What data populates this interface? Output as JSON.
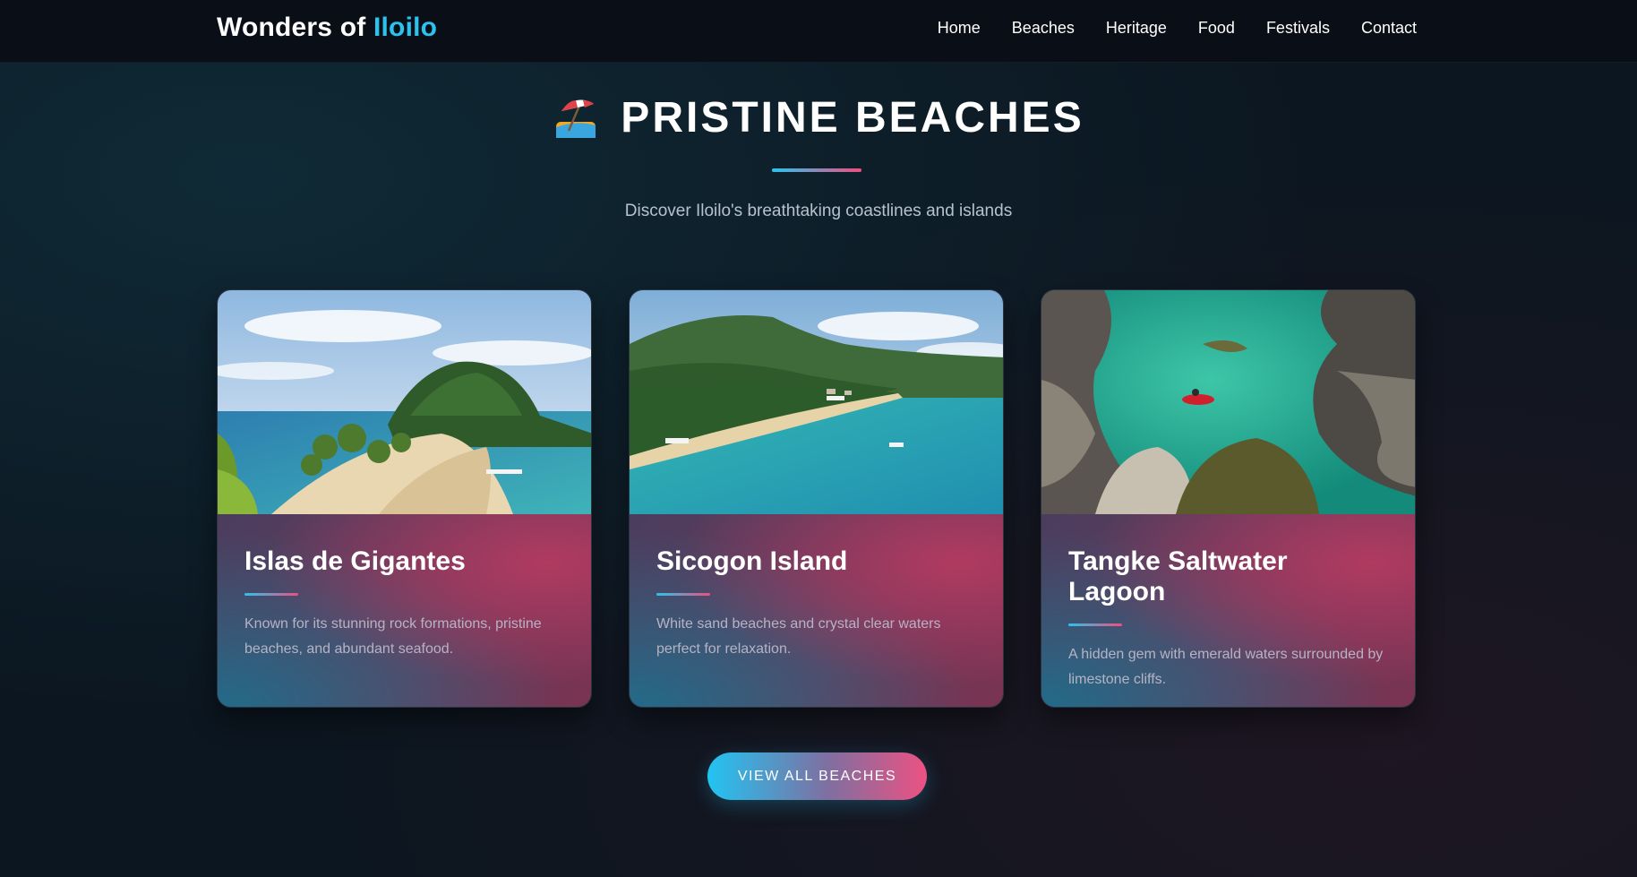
{
  "nav": {
    "brand_prefix": "Wonders of ",
    "brand_accent": "Iloilo",
    "links": [
      "Home",
      "Beaches",
      "Heritage",
      "Food",
      "Festivals",
      "Contact"
    ]
  },
  "section": {
    "icon": "beach-umbrella-icon",
    "title": "PRISTINE BEACHES",
    "subtitle": "Discover Iloilo's breathtaking coastlines and islands"
  },
  "cards": [
    {
      "title": "Islas de Gigantes",
      "description": "Known for its stunning rock formations, pristine beaches, and abundant seafood."
    },
    {
      "title": "Sicogon Island",
      "description": "White sand beaches and crystal clear waters perfect for relaxation."
    },
    {
      "title": "Tangke Saltwater Lagoon",
      "description": "A hidden gem with emerald waters surrounded by limestone cliffs."
    }
  ],
  "cta": {
    "label": "VIEW ALL BEACHES"
  },
  "colors": {
    "accent_cyan": "#2bc3ee",
    "accent_pink": "#ee4f7f",
    "nav_bg": "#0a0e17",
    "page_bg": "#0c1620"
  }
}
